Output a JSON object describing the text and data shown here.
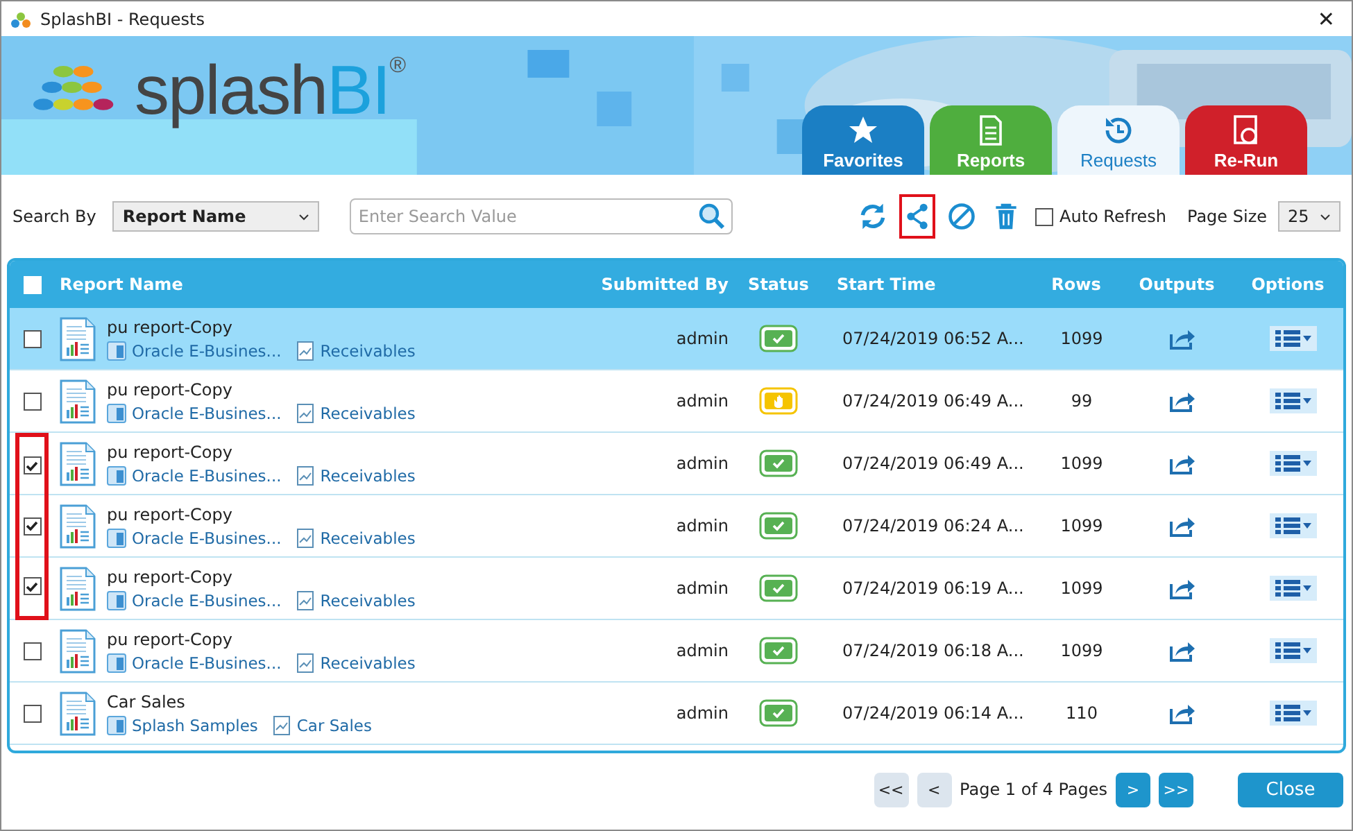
{
  "window": {
    "title": "SplashBI - Requests",
    "close": "✕"
  },
  "logo": {
    "text": "splash",
    "accent": "BI",
    "mark": "®"
  },
  "tabs": [
    {
      "label": "Favorites",
      "kind": "star",
      "color": "#1b7fc4",
      "selected": false
    },
    {
      "label": "Reports",
      "kind": "page",
      "color": "#4fae3e",
      "selected": false
    },
    {
      "label": "Requests",
      "kind": "history",
      "color": "#1b7fc4",
      "selected": true
    },
    {
      "label": "Re-Run",
      "kind": "rerun",
      "color": "#d0202a",
      "selected": false
    }
  ],
  "toolbar": {
    "search_by_label": "Search By",
    "search_by": "Report Name",
    "search": {
      "placeholder": "Enter Search Value"
    },
    "actions": [
      {
        "kind": "refresh",
        "highlighted": false
      },
      {
        "kind": "share",
        "highlighted": true
      },
      {
        "kind": "cancel",
        "highlighted": false
      },
      {
        "kind": "delete",
        "highlighted": false
      }
    ],
    "auto_refresh": {
      "label": "Auto Refresh",
      "checked": false
    },
    "page_size_label": "Page Size",
    "page_size": "25"
  },
  "table": {
    "select_all": {
      "checked": false
    },
    "columns": [
      "Report Name",
      "Submitted By",
      "Status",
      "Start Time",
      "Rows",
      "Outputs",
      "Options"
    ],
    "rows": [
      {
        "name": "pu report-Copy",
        "source": "Oracle E-Busines...",
        "category": "Receivables",
        "submitted_by": "admin",
        "kind": "done",
        "start_time": "07/24/2019 06:52 A...",
        "rows": "1099",
        "selected": true,
        "checked": false,
        "highlighted": false
      },
      {
        "name": "pu report-Copy",
        "source": "Oracle E-Busines...",
        "category": "Receivables",
        "submitted_by": "admin",
        "kind": "hold",
        "start_time": "07/24/2019 06:49 A...",
        "rows": "99",
        "selected": false,
        "checked": false,
        "highlighted": false
      },
      {
        "name": "pu report-Copy",
        "source": "Oracle E-Busines...",
        "category": "Receivables",
        "submitted_by": "admin",
        "kind": "done",
        "start_time": "07/24/2019 06:49 A...",
        "rows": "1099",
        "selected": false,
        "checked": true,
        "highlighted": true
      },
      {
        "name": "pu report-Copy",
        "source": "Oracle E-Busines...",
        "category": "Receivables",
        "submitted_by": "admin",
        "kind": "done",
        "start_time": "07/24/2019 06:24 A...",
        "rows": "1099",
        "selected": false,
        "checked": true,
        "highlighted": true
      },
      {
        "name": "pu report-Copy",
        "source": "Oracle E-Busines...",
        "category": "Receivables",
        "submitted_by": "admin",
        "kind": "done",
        "start_time": "07/24/2019 06:19 A...",
        "rows": "1099",
        "selected": false,
        "checked": true,
        "highlighted": true
      },
      {
        "name": "pu report-Copy",
        "source": "Oracle E-Busines...",
        "category": "Receivables",
        "submitted_by": "admin",
        "kind": "done",
        "start_time": "07/24/2019 06:18 A...",
        "rows": "1099",
        "selected": false,
        "checked": false,
        "highlighted": false
      },
      {
        "name": "Car Sales",
        "source": "Splash Samples",
        "category": "Car Sales",
        "submitted_by": "admin",
        "kind": "done",
        "start_time": "07/24/2019 06:14 A...",
        "rows": "110",
        "selected": false,
        "checked": false,
        "highlighted": false
      }
    ]
  },
  "pager": {
    "first": "<<",
    "prev": "<",
    "text": "Page 1 of 4 Pages",
    "next": ">",
    "last": ">>"
  },
  "close_button": "Close"
}
